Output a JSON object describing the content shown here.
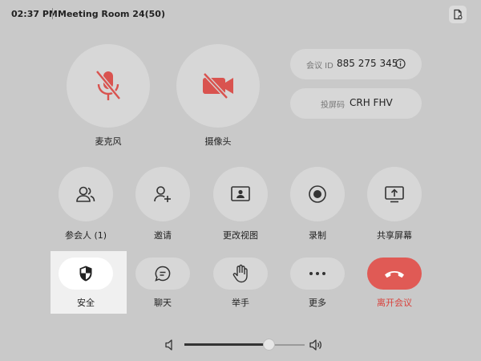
{
  "status": {
    "time": "02:37 PM",
    "room": "Meeting Room 24(50)"
  },
  "primary": {
    "mic_label": "麦克风",
    "camera_label": "摄像头"
  },
  "meeting": {
    "id_label": "会议 ID",
    "id_value": "885 275 345",
    "cast_label": "投屏码",
    "cast_value": "CRH FHV"
  },
  "actions": [
    {
      "label": "参会人 (1)"
    },
    {
      "label": "邀请"
    },
    {
      "label": "更改视图"
    },
    {
      "label": "录制"
    },
    {
      "label": "共享屏幕"
    }
  ],
  "bottom": [
    {
      "label": "安全"
    },
    {
      "label": "聊天"
    },
    {
      "label": "举手"
    },
    {
      "label": "更多"
    },
    {
      "label": "离开会议"
    }
  ],
  "volume": {
    "level": 0.7
  },
  "colors": {
    "accent_red": "#d9413c",
    "bg": "#c9c9c9",
    "button": "#d7d7d7"
  }
}
